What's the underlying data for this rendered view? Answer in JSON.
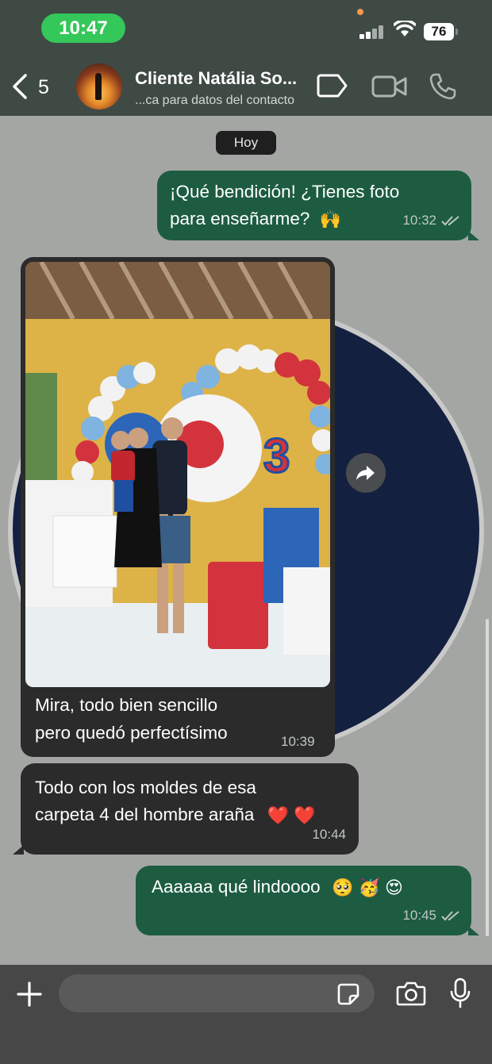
{
  "status_bar": {
    "time": "10:47",
    "battery": "76"
  },
  "header": {
    "back_count": "5",
    "contact_name": "Cliente Natália So...",
    "contact_subtitle": "...ca para datos del contacto"
  },
  "chat": {
    "day_label": "Hoy",
    "messages": [
      {
        "direction": "out",
        "line1": "¡Qué bendición! ¿Tienes foto",
        "line2": "para enseñarme?",
        "emoji": "🙌",
        "time": "10:32",
        "read": true
      },
      {
        "direction": "in",
        "line1": "Mira, todo bien sencillo",
        "line2": "pero quedó perfectísimo",
        "time": "10:39",
        "has_photo": true
      },
      {
        "direction": "in",
        "line1": "Todo con los moldes de esa",
        "line2": "carpeta 4 del hombre araña",
        "emoji": "❤️ ❤️",
        "time": "10:44"
      },
      {
        "direction": "out",
        "line1": "Aaaaaa qué lindoooo",
        "emoji": "🥺 🥳 😍",
        "time": "10:45",
        "read": true
      }
    ],
    "photo_cake_number": "3"
  },
  "composer": {
    "input_placeholder": ""
  },
  "colors": {
    "header_bg": "#3f4a44",
    "chat_bg": "#a4a6a4",
    "outgoing_bubble": "#1d5c41",
    "incoming_bubble": "#2b2b2b",
    "status_pill": "#34c759"
  }
}
